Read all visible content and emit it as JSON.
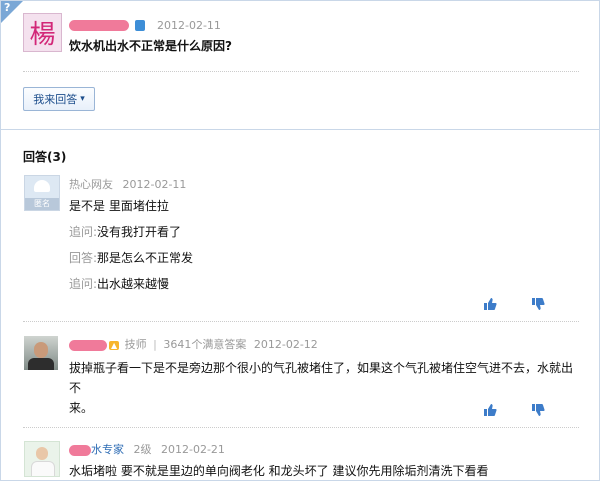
{
  "question": {
    "date": "2012-02-11",
    "title": "饮水机出水不正常是什么原因?",
    "avatar_char": "楊",
    "answer_button": "我来回答",
    "answer_button_arrow": "▾"
  },
  "answers_header": "回答(3)",
  "answers": [
    {
      "avatar_label": "匿名",
      "user": "热心网友",
      "date": "2012-02-11",
      "text": "是不是 里面堵住拉",
      "followups": [
        {
          "label": "追问:",
          "text": "没有我打开看了"
        },
        {
          "label": "回答:",
          "text": "那是怎么不正常发"
        },
        {
          "label": "追问:",
          "text": "出水越来越慢"
        }
      ]
    },
    {
      "title_label": "技师",
      "sep": "|",
      "satisfied": "3641个满意答案",
      "date": "2012-02-12",
      "text_line1": "拔掉瓶子看一下是不是旁边那个很小的气孔被堵住了，如果这个气孔被堵住空气进不去，水就出不",
      "text_line2": "来。"
    },
    {
      "user_suffix": "水专家",
      "level": "2级",
      "date": "2012-02-21",
      "text": "水垢堵啦 要不就是里边的单向阀老化 和龙头坏了 建议你先用除垢剂清洗下看看"
    }
  ],
  "icons": {
    "thumb_up": "thumbs-up-icon",
    "thumb_down": "thumbs-down-icon"
  }
}
